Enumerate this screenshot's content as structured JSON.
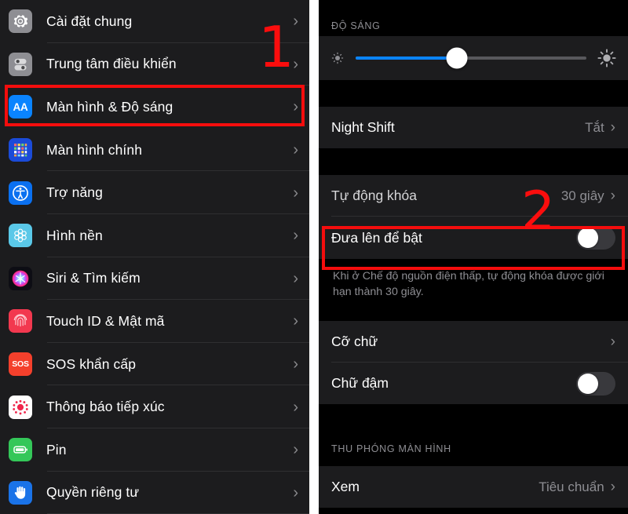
{
  "left_panel": {
    "name": "ios-settings-list",
    "items": [
      {
        "label": "Cài đặt chung",
        "icon": "gear-icon"
      },
      {
        "label": "Trung tâm điều khiển",
        "icon": "control-center-icon"
      },
      {
        "label": "Màn hình & Độ sáng",
        "icon": "display-brightness-aa-icon",
        "highlighted": true
      },
      {
        "label": "Màn hình chính",
        "icon": "home-screen-icon"
      },
      {
        "label": "Trợ năng",
        "icon": "accessibility-icon"
      },
      {
        "label": "Hình nền",
        "icon": "wallpaper-icon"
      },
      {
        "label": "Siri & Tìm kiếm",
        "icon": "siri-icon"
      },
      {
        "label": "Touch ID & Mật mã",
        "icon": "touch-id-fingerprint-icon"
      },
      {
        "label": "SOS khẩn cấp",
        "icon": "sos-icon"
      },
      {
        "label": "Thông báo tiếp xúc",
        "icon": "exposure-notification-icon"
      },
      {
        "label": "Pin",
        "icon": "battery-icon"
      },
      {
        "label": "Quyền riêng tư",
        "icon": "privacy-hand-icon"
      }
    ],
    "chevron": "›"
  },
  "right_panel": {
    "name": "display-and-brightness-screen",
    "brightness_section": {
      "header": "ĐỘ SÁNG",
      "slider": {
        "name": "brightness-slider",
        "value_percent": 44,
        "low_icon": "brightness-low-icon",
        "high_icon": "brightness-high-icon",
        "fill_color": "#0a84ff",
        "track_color": "#58585c"
      }
    },
    "night_shift": {
      "label": "Night Shift",
      "value": "Tắt",
      "chevron": "›"
    },
    "auto_lock": {
      "label": "Tự động khóa",
      "value": "30 giây",
      "chevron": "›"
    },
    "raise_to_wake": {
      "label": "Đưa lên để bật",
      "toggle_state": "off",
      "highlighted": true
    },
    "footnote": "Khi ở Chế độ nguồn điện thấp, tự động khóa được giới hạn thành 30 giây.",
    "text_size": {
      "label": "Cỡ chữ",
      "chevron": "›"
    },
    "bold_text": {
      "label": "Chữ đậm",
      "toggle_state": "off"
    },
    "zoom_section": {
      "header": "THU PHÓNG MÀN HÌNH",
      "view_row": {
        "label": "Xem",
        "value": "Tiêu chuẩn",
        "chevron": "›"
      }
    }
  },
  "annotations": {
    "step_one": {
      "label": "1",
      "color": "#fb0d0d"
    },
    "step_two": {
      "label": "2",
      "color": "#fb0d0d"
    },
    "highlight_color": "#f40d0d"
  }
}
